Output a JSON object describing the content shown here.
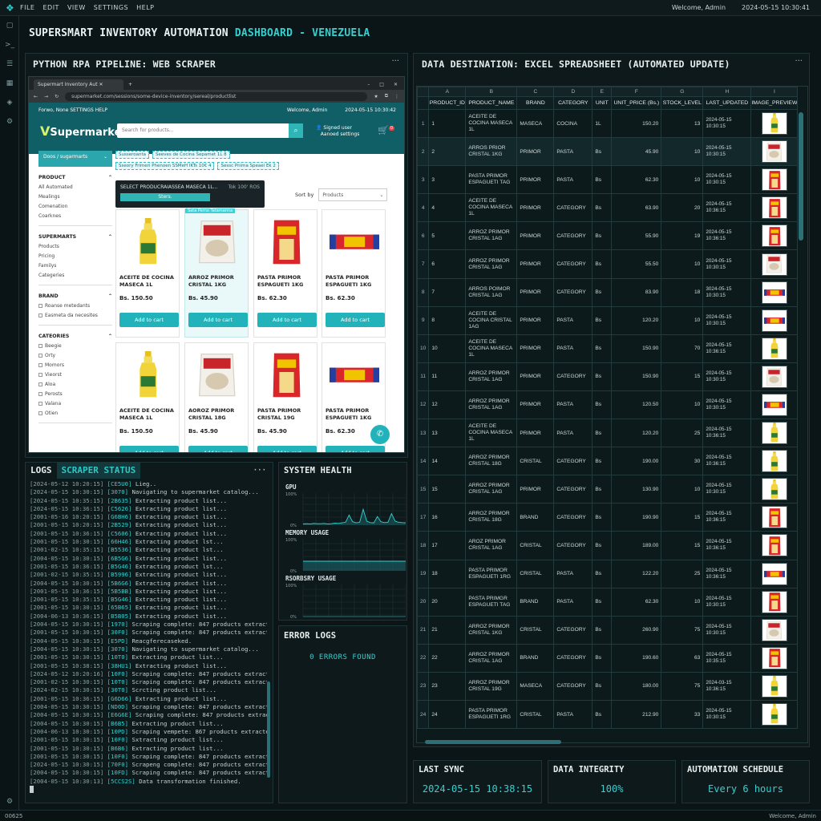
{
  "menubar": {
    "items": [
      "FILE",
      "EDIT",
      "VIEW",
      "SETTINGS",
      "HELP"
    ],
    "welcome": "Welcome, Admin",
    "datetime": "2024-05-15 10:30:41"
  },
  "statusbar": {
    "left": "00625",
    "right": "Welcome, Admin"
  },
  "dashboard": {
    "title_main": "SUPERSMART INVENTORY AUTOMATION ",
    "title_accent": "DASHBOARD - VENEZUELA"
  },
  "left_panel": {
    "title": "PYTHON RPA PIPELINE: WEB SCRAPER"
  },
  "right_panel": {
    "title": "DATA DESTINATION: EXCEL SPREADSHEET (AUTOMATED UPDATE)"
  },
  "browser": {
    "tab_title": "Supermart Inventory Aut",
    "url": "supermarket.com/sessions/some-device-inventory/sereal/productlist",
    "site": {
      "top_left": "Forwo, None   SETTINGS   HELP",
      "top_welcome": "Welcome, Admin",
      "top_date": "2024-05-15 10:30:42",
      "brand": "Supermarket",
      "search_placeholder": "Search for products...",
      "account_line1": "Signed user",
      "account_line2": "Aanoed settings",
      "cart_count": "0"
    },
    "sidebar": {
      "category_btn": "Doos / sugarmarts",
      "sections": [
        {
          "title": "PRODUCT",
          "items": [
            "All Automated",
            "Mealings",
            "Comenation",
            "Coarknes"
          ],
          "checkbox": false
        },
        {
          "title": "SUPERMARTS",
          "items": [
            "Products",
            "Pricing",
            "Familys",
            "Categeries"
          ],
          "checkbox": false
        },
        {
          "title": "BRAND",
          "items": [
            "Roanse metedants",
            "Easmeta da necesites"
          ],
          "checkbox": true
        },
        {
          "title": "CATEORIES",
          "items": [
            "Beegie",
            "Orty",
            "Momors",
            "Vieorst",
            "Aloa",
            "Perosts",
            "Valana",
            "Otien"
          ],
          "checkbox": true
        }
      ]
    },
    "crumbs": [
      "Susseroanta",
      "Seeves de Cocina Sepamet 1L 8",
      "Sseory Frimeri Phenoen SSMeH IKTs 10€ 4",
      "Sessc Pnima Speaei Ek 2"
    ],
    "tooltip": {
      "text": "SELECT PRODUCRAIASSEA MASECA 1L...",
      "bar": "Sters.",
      "meta": "Tok 100'    ROS"
    },
    "sort_label": "Sort by",
    "sort_value": "Products",
    "add_label": "Add to cart",
    "highlight_tag": "Sata Perno Tatamanna",
    "products": [
      {
        "name": "ACEITE DE COCINA MASECA 1L",
        "price": "Bs. 150.50",
        "img": "oil"
      },
      {
        "name": "ARROZ PRIMOR CRISTAL 1KG",
        "price": "Bs. 45.90",
        "img": "rice"
      },
      {
        "name": "PASTA PRIMOR ESPAGUETI 1KG",
        "price": "Bs. 62.30",
        "img": "pasta"
      },
      {
        "name": "PASTA PRIMOR ESPAGUETI 1KG",
        "price": "Bs. 62.30",
        "img": "spaghetti"
      },
      {
        "name": "ACEITE DE COCINA MASECA 1L",
        "price": "Bs. 150.50",
        "img": "oil"
      },
      {
        "name": "AOROZ PRIMOR CRISTAL 18G",
        "price": "Bs. 45.90",
        "img": "rice"
      },
      {
        "name": "PASTA PRIMOR CRISTAL 19G",
        "price": "Bs. 45.90",
        "img": "pasta"
      },
      {
        "name": "PASTA PRIMOR ESPAGUETI 1KG",
        "price": "Bs. 62.30",
        "img": "spaghetti"
      }
    ]
  },
  "sheet": {
    "col_letters": [
      "A",
      "B",
      "C",
      "D",
      "E",
      "F",
      "G",
      "H",
      "I"
    ],
    "headers": [
      "PRODUCT_ID",
      "PRODUCT_NAME",
      "BRAND",
      "CATEGORY",
      "UNIT",
      "UNIT_PRICE (Bs.)",
      "STOCK_LEVEL",
      "LAST_UPDATED",
      "IMAGE_PREVIEW"
    ],
    "rows": [
      {
        "rn": "1",
        "id": "1",
        "name": "ACEITE DE COCINA MASECA 1L",
        "brand": "MASECA",
        "cat": "COCINA",
        "unit": "1L",
        "price": "150.20",
        "stock": "13",
        "date": "2024-05-15 10:30:15",
        "img": "oil"
      },
      {
        "rn": "2",
        "id": "2",
        "name": "ARROS PRIOR CRISTAL 1KG",
        "brand": "PRIMOR",
        "cat": "PASTA",
        "unit": "Bs",
        "price": "45.90",
        "stock": "10",
        "date": "2024-05-15 10:30:15",
        "img": "rice"
      },
      {
        "rn": "3",
        "id": "3",
        "name": "PASTA PRIMOR ESPAGUETI TAG",
        "brand": "PRIMOR",
        "cat": "PASTA",
        "unit": "Bs",
        "price": "62.30",
        "stock": "10",
        "date": "2024-05-15 10:30:15",
        "img": "pasta"
      },
      {
        "rn": "4",
        "id": "4",
        "name": "ACEITE DE COCINA MASECA 1L",
        "brand": "PRIMOR",
        "cat": "CATEGORY",
        "unit": "Bs",
        "price": "63.90",
        "stock": "20",
        "date": "2024-05-15 10:36:15",
        "img": "pasta"
      },
      {
        "rn": "6",
        "id": "5",
        "name": "ARROZ PRIMOR CRISTAL 1AG",
        "brand": "PRIMOR",
        "cat": "CATEGORY",
        "unit": "Bs",
        "price": "55.90",
        "stock": "19",
        "date": "2024-05-15 10:36:15",
        "img": "pasta"
      },
      {
        "rn": "7",
        "id": "6",
        "name": "ARROZ PRIMOR CRISTAL 1AG",
        "brand": "PRIMOR",
        "cat": "CATEGORY",
        "unit": "Bs",
        "price": "55.50",
        "stock": "10",
        "date": "2024-05-15 10:30:15",
        "img": "rice"
      },
      {
        "rn": "8",
        "id": "7",
        "name": "ARROS POIMOR CRISTAL 1AG",
        "brand": "PRIMOR",
        "cat": "CATEGORY",
        "unit": "Bs",
        "price": "83.90",
        "stock": "18",
        "date": "3024-05-15 10:30:15",
        "img": "spaghetti"
      },
      {
        "rn": "9",
        "id": "8",
        "name": "ACEITE DE COCINA CRISTAL 1AG",
        "brand": "PRIMOR",
        "cat": "PASTA",
        "unit": "Bs",
        "price": "120.20",
        "stock": "10",
        "date": "2024-05-15 10:30:15",
        "img": "spaghetti"
      },
      {
        "rn": "10",
        "id": "10",
        "name": "ACEITE DE COCINA MASECA 1L",
        "brand": "PRIMOR",
        "cat": "PASTA",
        "unit": "Bs",
        "price": "150.90",
        "stock": "70",
        "date": "2024-05-15 10:36:15",
        "img": "oil"
      },
      {
        "rn": "11",
        "id": "11",
        "name": "ARROZ PRIMOR CRISTAL 1AG",
        "brand": "PRIMOR",
        "cat": "CATEGORY",
        "unit": "Bs",
        "price": "150.90",
        "stock": "15",
        "date": "2024-05-15 10:30:15",
        "img": "rice"
      },
      {
        "rn": "12",
        "id": "12",
        "name": "ARROZ PRIMOR CRISTAL 1AG",
        "brand": "PRIMOR",
        "cat": "PASTA",
        "unit": "Bs",
        "price": "120.50",
        "stock": "10",
        "date": "2024-05-15 10:30:15",
        "img": "spaghetti"
      },
      {
        "rn": "13",
        "id": "13",
        "name": "ACEITE DE COCINA MASECA 1L",
        "brand": "PRIMOR",
        "cat": "PASTA",
        "unit": "Bs",
        "price": "120.20",
        "stock": "25",
        "date": "2024-05-15 10:36:15",
        "img": "oil"
      },
      {
        "rn": "14",
        "id": "14",
        "name": "ARROZ PRIMOR CRISTAL 18G",
        "brand": "CRISTAL",
        "cat": "CATEGORY",
        "unit": "Bs",
        "price": "190.00",
        "stock": "30",
        "date": "2024-05-15 10:36:15",
        "img": "oil"
      },
      {
        "rn": "15",
        "id": "15",
        "name": "ARROZ PRIMOR CRISTAL 1AG",
        "brand": "PRIMOR",
        "cat": "CATEGORY",
        "unit": "Bs",
        "price": "130.90",
        "stock": "10",
        "date": "2024-05-15 10:30:15",
        "img": "oil"
      },
      {
        "rn": "17",
        "id": "16",
        "name": "ARROZ PRIMOR CRISTAL 18G",
        "brand": "BRAND",
        "cat": "CATEGORY",
        "unit": "Bs",
        "price": "190.90",
        "stock": "15",
        "date": "2024-05-15 10:36:15",
        "img": "pasta"
      },
      {
        "rn": "18",
        "id": "17",
        "name": "AROZ PRIMOR CRISTAL 1AG",
        "brand": "CRISTAL",
        "cat": "CATEGORY",
        "unit": "Bs",
        "price": "189.00",
        "stock": "15",
        "date": "2024-05-15 10:36:15",
        "img": "pasta"
      },
      {
        "rn": "19",
        "id": "18",
        "name": "PASTA PRIMOR ESPAGUETI 1RG",
        "brand": "CRISTAL",
        "cat": "PASTA",
        "unit": "Bs",
        "price": "122.20",
        "stock": "25",
        "date": "2024-05-15 10:36:15",
        "img": "spaghetti"
      },
      {
        "rn": "20",
        "id": "20",
        "name": "PASTA PRIMGR ESPAGUETI TAG",
        "brand": "BRAND",
        "cat": "PASTA",
        "unit": "Bs",
        "price": "62.30",
        "stock": "10",
        "date": "2024-05-15 10:30:15",
        "img": "pasta"
      },
      {
        "rn": "21",
        "id": "21",
        "name": "ARROZ PRIMOR CRISTAL 1KG",
        "brand": "CRISTAL",
        "cat": "CATEGORY",
        "unit": "Bs",
        "price": "260.90",
        "stock": "75",
        "date": "2024-05-15 10:30:15",
        "img": "rice"
      },
      {
        "rn": "22",
        "id": "22",
        "name": "ARROZ PRIMOR CRISTAL 1AG",
        "brand": "BRAND",
        "cat": "CATEGORY",
        "unit": "Bs",
        "price": "190.60",
        "stock": "63",
        "date": "2024-05-15 10:35:15",
        "img": "pasta"
      },
      {
        "rn": "23",
        "id": "23",
        "name": "ARROZ PRIMOR CRISTAL 19G",
        "brand": "MASECA",
        "cat": "CATEGORY",
        "unit": "Bs",
        "price": "180.00",
        "stock": "75",
        "date": "2024-03-15 10:36:15",
        "img": "oil"
      },
      {
        "rn": "24",
        "id": "24",
        "name": "PASTA PRIMOR ESPAGUETI 1RG",
        "brand": "CRISTAL",
        "cat": "PASTA",
        "unit": "Bs",
        "price": "212.90",
        "stock": "33",
        "date": "2024-05-15 10:30:15",
        "img": "oil"
      }
    ]
  },
  "logs": {
    "tab_logs": "LOGS",
    "tab_status": "SCRAPER STATUS",
    "lines": [
      [
        "[2024-05-12 10:20:15]",
        "[CE5U0]",
        "Lieg.."
      ],
      [
        "[2024-05-15 10:30:15]",
        "[3070]",
        "Navigating to supermarket catalog..."
      ],
      [
        "[2024-05-15 10:35:15]",
        "[2B635]",
        "Extracting product list..."
      ],
      [
        "[2024-05-15 10:36:15]",
        "[C5626]",
        "Extracting product list..."
      ],
      [
        "[2001-05-16 10:20:15]",
        "[G6BH6]",
        "Extracting product list..."
      ],
      [
        "[2001-05-15 10:20:15]",
        "[2B529]",
        "Extracting product list..."
      ],
      [
        "[2001-05-15 10:36:15]",
        "[C5606]",
        "Extracting product list..."
      ],
      [
        "[2001-05-15 10:30:15]",
        "[66H46]",
        "Extracting product lst..."
      ],
      [
        "[2001-02-15 10:35:15]",
        "[B5536]",
        "Extracting product lst..."
      ],
      [
        "[2004-05-15 10:30:15]",
        "[6B5G6]",
        "Extracting product list..."
      ],
      [
        "[2001-05-15 10:36:15]",
        "[B5G46]",
        "Extracting product lst..."
      ],
      [
        "[2001-02-15 10:35:15]",
        "[B5996]",
        "Extracting product list..."
      ],
      [
        "[2004-05-15 10:30:15]",
        "[5B6G6]",
        "Extracting product list..."
      ],
      [
        "[2001-05-15 10:36:15]",
        "[5B5BB]",
        "Extracting product list..."
      ],
      [
        "[2001-05-15 10:35:15]",
        "[B5G46]",
        "Extracting product list..."
      ],
      [
        "[2001-05-15 10:30:15]",
        "[65B65]",
        "Extracting product list..."
      ],
      [
        "[2004-06-13 10:36:15]",
        "[B5B05]",
        "Extracting product list..."
      ],
      [
        "[2004-05-15 10:30:15]",
        "[1970]",
        "Scraping complete: 847 products extracted"
      ],
      [
        "[2001-05-15 10:30:15]",
        "[30F0]",
        "Scraping complete: 847 products extracted"
      ],
      [
        "[2004-05-15 10:30:15]",
        "[E5PD]",
        "Reacgferecaseked."
      ],
      [
        "[2004-05-15 10:30:15]",
        "[3070]",
        "Navigating to supermarket catalog..."
      ],
      [
        "[2001-05-15 10:30:15]",
        "[10T0]",
        "Extracting product list..."
      ],
      [
        "[2001-05-15 10:38:15]",
        "[38HU1]",
        "Extracting product list..."
      ],
      [
        "[2024-05-12 10:20:16]",
        "[10F0]",
        "Scraping complete: 847 products extracted"
      ],
      [
        "[2001-02-15 10:30:15]",
        "[10T0]",
        "Scraping complete: 847 products extracted"
      ],
      [
        "[2024-02-15 10:30:15]",
        "[30T0]",
        "Scrcting product list..."
      ],
      [
        "[2001-05-15 10:36:15]",
        "[G6D66]",
        "Extracting product list..."
      ],
      [
        "[2004-05-15 10:30:15]",
        "[ND0D]",
        "Scraping complete: 847 products extracted"
      ],
      [
        "[2004-05-15 10:30:15]",
        "[E6G6E]",
        "Scraping complete: 847 products extracted"
      ],
      [
        "[2004-05-15 10:30:15]",
        "[B6B5]",
        "Extracting product list..."
      ],
      [
        "[2004-06-13 10:30:15]",
        "[10PD]",
        "Scraping vempete: 867 products extracted"
      ],
      [
        "[2001-05-15 10:30:15]",
        "[10F0]",
        "Sxtracting product list..."
      ],
      [
        "[2001-05-15 10:30:15]",
        "[B6B6]",
        "Extracting product list..."
      ],
      [
        "[2001-05-15 10:30:15]",
        "[10F0]",
        "Scraping complete: 847 products extracted"
      ],
      [
        "[2024-05-15 10:30:15]",
        "[70F0]",
        "Scrapeng complete: 847 products extracted"
      ],
      [
        "[2004-05-15 10:30:15]",
        "[10FD]",
        "Scraping complete: 847 products extracted"
      ],
      [
        "[2004-05-15 10:30:13]",
        "[5CCS2S]",
        "Data transformation finished."
      ]
    ]
  },
  "health": {
    "title": "SYSTEM HEALTH",
    "gpu_label": "GPU",
    "mem_label": "MEMORY USAGE",
    "other_label": "RSORBSRY USAGE",
    "axis_top": "100%",
    "axis_bottom": "0%",
    "gpu_series": [
      4,
      5,
      4,
      6,
      5,
      5,
      6,
      4,
      5,
      7,
      6,
      8,
      10,
      35,
      12,
      8,
      10,
      55,
      14,
      9,
      8,
      30,
      12,
      9,
      10,
      40,
      14,
      10,
      9,
      8
    ],
    "mem_level": 0.3,
    "other_level": 0
  },
  "errors": {
    "title": "ERROR LOGS",
    "text": "0 ERRORS FOUND"
  },
  "cards": [
    {
      "title": "LAST SYNC",
      "value": "2024-05-15 10:38:15"
    },
    {
      "title": "DATA INTEGRITY",
      "value": "100%"
    },
    {
      "title": "AUTOMATION SCHEDULE",
      "value": "Every 6 hours"
    }
  ],
  "colors": {
    "accent": "#35d0cf",
    "bg": "#0b1416",
    "brand_teal": "#105e66"
  }
}
